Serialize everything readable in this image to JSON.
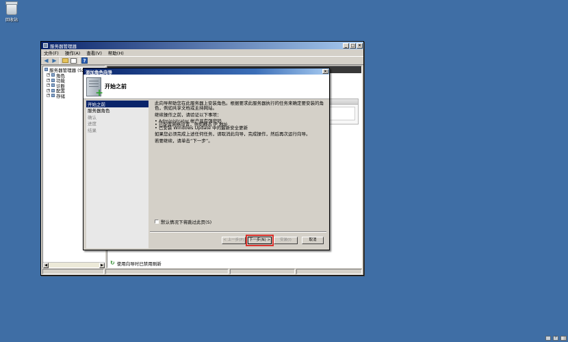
{
  "desktop": {
    "recycle_bin_label": "回收站"
  },
  "server_manager": {
    "title": "服务器管理器",
    "window_buttons": [
      "_",
      "□",
      "×"
    ],
    "menu": [
      "文件(F)",
      "操作(A)",
      "查看(V)",
      "帮助(H)"
    ],
    "toolbar_icons": [
      "back-arrow-icon",
      "forward-arrow-icon",
      "folder-icon",
      "grid-icon",
      "help-icon"
    ],
    "tree": {
      "root": "服务器管理器 (Sz",
      "items": [
        "角色",
        "功能",
        "诊断",
        "配置",
        "存储"
      ]
    },
    "refresh_status": "使用向导时已禁用刷新"
  },
  "wizard": {
    "title": "添加角色向导",
    "heading": "开始之前",
    "nav": [
      {
        "label": "开始之前",
        "state": "active"
      },
      {
        "label": "服务器角色",
        "state": "normal"
      },
      {
        "label": "确认",
        "state": "disabled"
      },
      {
        "label": "进度",
        "state": "disabled"
      },
      {
        "label": "结果",
        "state": "disabled"
      }
    ],
    "content": {
      "intro": "此向导帮助您在此服务器上安装角色。根据要求此服务器执行的任务来确定要安装的角色，例如共享文档或主持网站。",
      "before_continue": "继续操作之前，请验证以下事项：",
      "bullets": [
        "Administrator 帐户具有强密码",
        "已配置网络设置，例如静态 IP 地址",
        "已安装 Windows Update 中的最新安全更新"
      ],
      "incomplete_note": "如果您必须完成上述任何任务，请取消此向导，完成操作，然后再次运行向导。",
      "continue_note": "若要继续，请单击“下一步”。",
      "skip_checkbox_label": "默认情况下将跳过此页(S)"
    },
    "buttons": {
      "prev": "< 上一步(P)",
      "next": "下一步(N) >",
      "install": "安装(I)",
      "cancel": "取消"
    }
  },
  "colors": {
    "desktop": "#3f6ea5",
    "selection": "#0a246a",
    "highlight_outline": "#d9312b"
  }
}
